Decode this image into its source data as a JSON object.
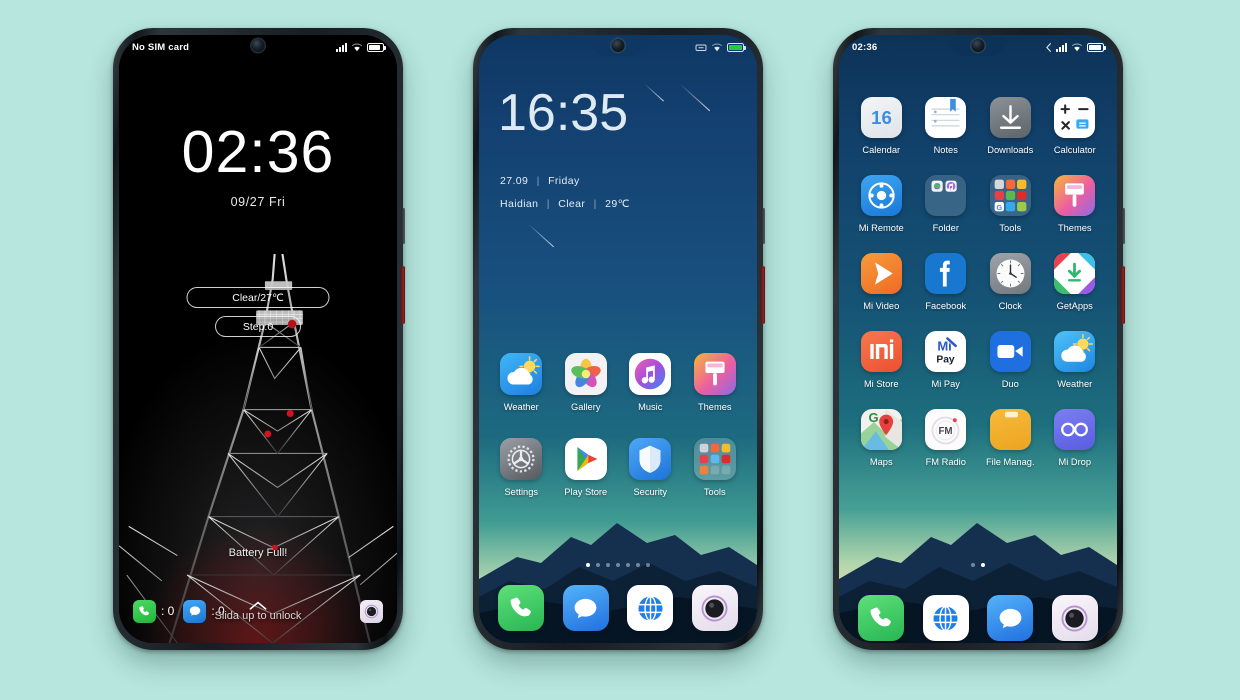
{
  "background_color": "#b6e6dd",
  "phones": {
    "lock": {
      "name": "lock-screen-phone",
      "statusbar": {
        "carrier": "No SIM card",
        "icons": [
          "signal-icon",
          "wifi-icon",
          "battery-icon"
        ]
      },
      "clock": "02:36",
      "date": "09/27  Fri",
      "weather_pill": "Clear/27℃",
      "step_pill": "Step:0",
      "battery_status": "Battery Full!",
      "shortcuts": [
        {
          "icon": "phone-icon",
          "count": ": 0"
        },
        {
          "icon": "message-icon",
          "count": ": 0"
        },
        {
          "icon": "camera-icon",
          "count": ""
        }
      ],
      "unlock_hint": "Slida up to unlock",
      "wallpaper": "tokyo-tower-black-and-white"
    },
    "home": {
      "name": "home-screen-phone",
      "statusbar": {
        "carrier": "",
        "icons": [
          "no-sim-icon",
          "wifi-icon",
          "battery-green-icon"
        ]
      },
      "clock": "16:35",
      "date_line": {
        "date": "27.09",
        "sep": "|",
        "weekday": "Friday"
      },
      "weather_line": {
        "city": "Haidian",
        "sep1": "|",
        "condition": "Clear",
        "sep2": "|",
        "temp": "29℃"
      },
      "apps": [
        {
          "label": "Weather",
          "icon": "weather-icon"
        },
        {
          "label": "Gallery",
          "icon": "gallery-icon"
        },
        {
          "label": "Music",
          "icon": "music-icon"
        },
        {
          "label": "Themes",
          "icon": "themes-icon"
        },
        {
          "label": "Settings",
          "icon": "settings-icon"
        },
        {
          "label": "Play Store",
          "icon": "play-store-icon"
        },
        {
          "label": "Security",
          "icon": "security-icon"
        },
        {
          "label": "Tools",
          "icon": "tools-folder-icon"
        }
      ],
      "page_dots": {
        "count": 7,
        "active": 0
      },
      "dock": [
        {
          "label": "Phone",
          "icon": "phone-icon"
        },
        {
          "label": "Messages",
          "icon": "message-icon"
        },
        {
          "label": "Browser",
          "icon": "browser-icon"
        },
        {
          "label": "Camera",
          "icon": "camera-icon"
        }
      ]
    },
    "apps": {
      "name": "app-drawer-phone",
      "statusbar": {
        "carrier": "02:36",
        "icons": [
          "call-icon",
          "signal-icon",
          "wifi-icon",
          "battery-icon"
        ]
      },
      "apps": [
        {
          "label": "Calendar",
          "icon": "calendar-icon",
          "badge": "16"
        },
        {
          "label": "Notes",
          "icon": "notes-icon"
        },
        {
          "label": "Downloads",
          "icon": "downloads-icon"
        },
        {
          "label": "Calculator",
          "icon": "calculator-icon"
        },
        {
          "label": "Mi Remote",
          "icon": "mi-remote-icon"
        },
        {
          "label": "Folder",
          "icon": "folder-icon"
        },
        {
          "label": "Tools",
          "icon": "tools-folder-icon"
        },
        {
          "label": "Themes",
          "icon": "themes-icon"
        },
        {
          "label": "Mi Video",
          "icon": "mi-video-icon"
        },
        {
          "label": "Facebook",
          "icon": "facebook-icon"
        },
        {
          "label": "Clock",
          "icon": "clock-icon"
        },
        {
          "label": "GetApps",
          "icon": "getapps-icon"
        },
        {
          "label": "Mi Store",
          "icon": "mi-store-icon"
        },
        {
          "label": "Mi Pay",
          "icon": "mi-pay-icon"
        },
        {
          "label": "Duo",
          "icon": "duo-icon"
        },
        {
          "label": "Weather",
          "icon": "weather-icon"
        },
        {
          "label": "Maps",
          "icon": "maps-icon"
        },
        {
          "label": "FM Radio",
          "icon": "fm-radio-icon"
        },
        {
          "label": "File Manag.",
          "icon": "file-manager-icon"
        },
        {
          "label": "Mi Drop",
          "icon": "mi-drop-icon"
        }
      ],
      "page_dots": {
        "count": 2,
        "active": 1
      },
      "dock": [
        {
          "label": "Phone",
          "icon": "phone-icon"
        },
        {
          "label": "Browser",
          "icon": "browser-icon"
        },
        {
          "label": "Messages",
          "icon": "message-icon"
        },
        {
          "label": "Camera",
          "icon": "camera-icon"
        }
      ]
    }
  }
}
